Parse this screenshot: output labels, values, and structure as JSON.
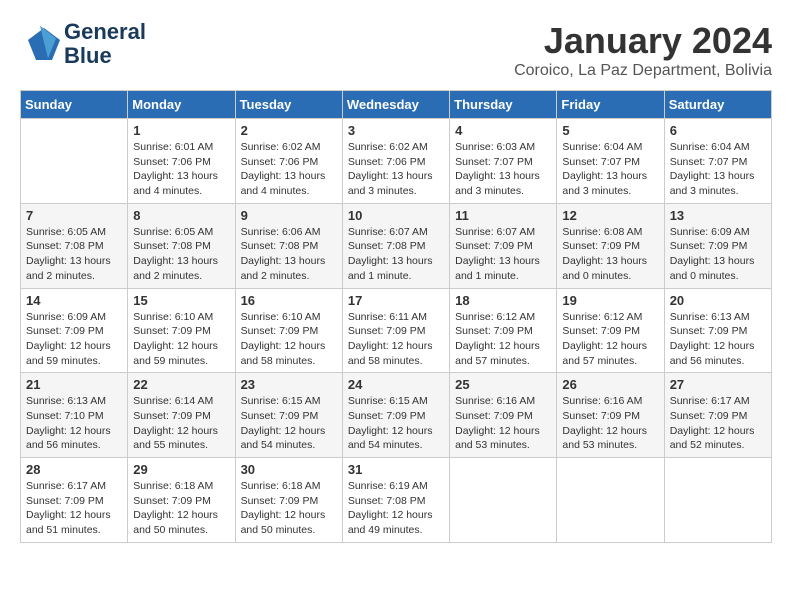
{
  "header": {
    "logo_line1": "General",
    "logo_line2": "Blue",
    "month": "January 2024",
    "location": "Coroico, La Paz Department, Bolivia"
  },
  "weekdays": [
    "Sunday",
    "Monday",
    "Tuesday",
    "Wednesday",
    "Thursday",
    "Friday",
    "Saturday"
  ],
  "weeks": [
    [
      {
        "day": "",
        "sunrise": "",
        "sunset": "",
        "daylight": ""
      },
      {
        "day": "1",
        "sunrise": "Sunrise: 6:01 AM",
        "sunset": "Sunset: 7:06 PM",
        "daylight": "Daylight: 13 hours and 4 minutes."
      },
      {
        "day": "2",
        "sunrise": "Sunrise: 6:02 AM",
        "sunset": "Sunset: 7:06 PM",
        "daylight": "Daylight: 13 hours and 4 minutes."
      },
      {
        "day": "3",
        "sunrise": "Sunrise: 6:02 AM",
        "sunset": "Sunset: 7:06 PM",
        "daylight": "Daylight: 13 hours and 3 minutes."
      },
      {
        "day": "4",
        "sunrise": "Sunrise: 6:03 AM",
        "sunset": "Sunset: 7:07 PM",
        "daylight": "Daylight: 13 hours and 3 minutes."
      },
      {
        "day": "5",
        "sunrise": "Sunrise: 6:04 AM",
        "sunset": "Sunset: 7:07 PM",
        "daylight": "Daylight: 13 hours and 3 minutes."
      },
      {
        "day": "6",
        "sunrise": "Sunrise: 6:04 AM",
        "sunset": "Sunset: 7:07 PM",
        "daylight": "Daylight: 13 hours and 3 minutes."
      }
    ],
    [
      {
        "day": "7",
        "sunrise": "Sunrise: 6:05 AM",
        "sunset": "Sunset: 7:08 PM",
        "daylight": "Daylight: 13 hours and 2 minutes."
      },
      {
        "day": "8",
        "sunrise": "Sunrise: 6:05 AM",
        "sunset": "Sunset: 7:08 PM",
        "daylight": "Daylight: 13 hours and 2 minutes."
      },
      {
        "day": "9",
        "sunrise": "Sunrise: 6:06 AM",
        "sunset": "Sunset: 7:08 PM",
        "daylight": "Daylight: 13 hours and 2 minutes."
      },
      {
        "day": "10",
        "sunrise": "Sunrise: 6:07 AM",
        "sunset": "Sunset: 7:08 PM",
        "daylight": "Daylight: 13 hours and 1 minute."
      },
      {
        "day": "11",
        "sunrise": "Sunrise: 6:07 AM",
        "sunset": "Sunset: 7:09 PM",
        "daylight": "Daylight: 13 hours and 1 minute."
      },
      {
        "day": "12",
        "sunrise": "Sunrise: 6:08 AM",
        "sunset": "Sunset: 7:09 PM",
        "daylight": "Daylight: 13 hours and 0 minutes."
      },
      {
        "day": "13",
        "sunrise": "Sunrise: 6:09 AM",
        "sunset": "Sunset: 7:09 PM",
        "daylight": "Daylight: 13 hours and 0 minutes."
      }
    ],
    [
      {
        "day": "14",
        "sunrise": "Sunrise: 6:09 AM",
        "sunset": "Sunset: 7:09 PM",
        "daylight": "Daylight: 12 hours and 59 minutes."
      },
      {
        "day": "15",
        "sunrise": "Sunrise: 6:10 AM",
        "sunset": "Sunset: 7:09 PM",
        "daylight": "Daylight: 12 hours and 59 minutes."
      },
      {
        "day": "16",
        "sunrise": "Sunrise: 6:10 AM",
        "sunset": "Sunset: 7:09 PM",
        "daylight": "Daylight: 12 hours and 58 minutes."
      },
      {
        "day": "17",
        "sunrise": "Sunrise: 6:11 AM",
        "sunset": "Sunset: 7:09 PM",
        "daylight": "Daylight: 12 hours and 58 minutes."
      },
      {
        "day": "18",
        "sunrise": "Sunrise: 6:12 AM",
        "sunset": "Sunset: 7:09 PM",
        "daylight": "Daylight: 12 hours and 57 minutes."
      },
      {
        "day": "19",
        "sunrise": "Sunrise: 6:12 AM",
        "sunset": "Sunset: 7:09 PM",
        "daylight": "Daylight: 12 hours and 57 minutes."
      },
      {
        "day": "20",
        "sunrise": "Sunrise: 6:13 AM",
        "sunset": "Sunset: 7:09 PM",
        "daylight": "Daylight: 12 hours and 56 minutes."
      }
    ],
    [
      {
        "day": "21",
        "sunrise": "Sunrise: 6:13 AM",
        "sunset": "Sunset: 7:10 PM",
        "daylight": "Daylight: 12 hours and 56 minutes."
      },
      {
        "day": "22",
        "sunrise": "Sunrise: 6:14 AM",
        "sunset": "Sunset: 7:09 PM",
        "daylight": "Daylight: 12 hours and 55 minutes."
      },
      {
        "day": "23",
        "sunrise": "Sunrise: 6:15 AM",
        "sunset": "Sunset: 7:09 PM",
        "daylight": "Daylight: 12 hours and 54 minutes."
      },
      {
        "day": "24",
        "sunrise": "Sunrise: 6:15 AM",
        "sunset": "Sunset: 7:09 PM",
        "daylight": "Daylight: 12 hours and 54 minutes."
      },
      {
        "day": "25",
        "sunrise": "Sunrise: 6:16 AM",
        "sunset": "Sunset: 7:09 PM",
        "daylight": "Daylight: 12 hours and 53 minutes."
      },
      {
        "day": "26",
        "sunrise": "Sunrise: 6:16 AM",
        "sunset": "Sunset: 7:09 PM",
        "daylight": "Daylight: 12 hours and 53 minutes."
      },
      {
        "day": "27",
        "sunrise": "Sunrise: 6:17 AM",
        "sunset": "Sunset: 7:09 PM",
        "daylight": "Daylight: 12 hours and 52 minutes."
      }
    ],
    [
      {
        "day": "28",
        "sunrise": "Sunrise: 6:17 AM",
        "sunset": "Sunset: 7:09 PM",
        "daylight": "Daylight: 12 hours and 51 minutes."
      },
      {
        "day": "29",
        "sunrise": "Sunrise: 6:18 AM",
        "sunset": "Sunset: 7:09 PM",
        "daylight": "Daylight: 12 hours and 50 minutes."
      },
      {
        "day": "30",
        "sunrise": "Sunrise: 6:18 AM",
        "sunset": "Sunset: 7:09 PM",
        "daylight": "Daylight: 12 hours and 50 minutes."
      },
      {
        "day": "31",
        "sunrise": "Sunrise: 6:19 AM",
        "sunset": "Sunset: 7:08 PM",
        "daylight": "Daylight: 12 hours and 49 minutes."
      },
      {
        "day": "",
        "sunrise": "",
        "sunset": "",
        "daylight": ""
      },
      {
        "day": "",
        "sunrise": "",
        "sunset": "",
        "daylight": ""
      },
      {
        "day": "",
        "sunrise": "",
        "sunset": "",
        "daylight": ""
      }
    ]
  ]
}
